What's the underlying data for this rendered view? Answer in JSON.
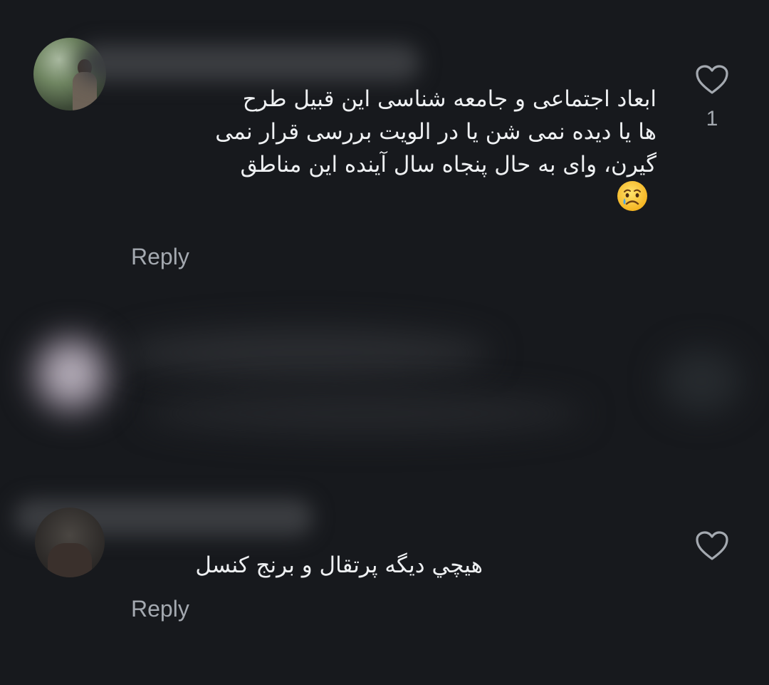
{
  "comments": [
    {
      "text_lines": [
        "ابعاد اجتماعی و جامعه شناسی این قبیل طرح",
        "ها یا دیده نمی شن یا در الویت بررسی قرار نمی",
        "گیرن، وای به حال پنجاه سال آینده این مناطق"
      ],
      "emoji": "😢",
      "reply_label": "Reply",
      "like_count": "1",
      "like_icon": "heart-outline-icon"
    },
    {
      "text": "هيچي ديگه پرتقال و برنج كنسل",
      "reply_label": "Reply",
      "like_icon": "heart-outline-icon"
    }
  ],
  "colors": {
    "background": "#17191d",
    "text": "#eef0f2",
    "secondary": "#a4a9b0"
  }
}
